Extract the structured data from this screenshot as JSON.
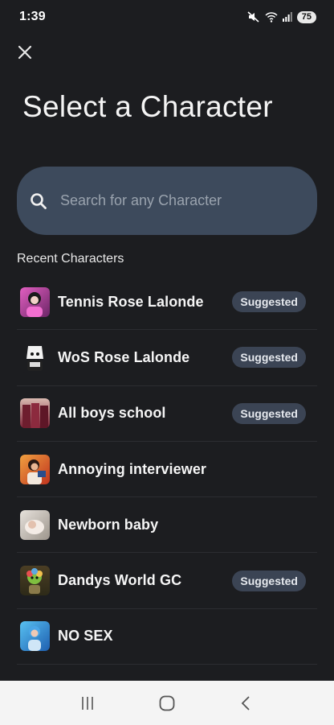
{
  "status_bar": {
    "time": "1:39",
    "battery": "75",
    "icons": [
      "mute-icon",
      "wifi-icon",
      "signal-icon",
      "battery-icon"
    ]
  },
  "header": {
    "close_icon": "close-icon",
    "title": "Select a Character"
  },
  "search": {
    "placeholder": "Search for any Character",
    "value": "",
    "icon": "search-icon"
  },
  "recent": {
    "label": "Recent Characters",
    "items": [
      {
        "name": "Tennis Rose Lalonde",
        "badge": "Suggested",
        "avatar_color": "#b04a9e"
      },
      {
        "name": "WoS Rose Lalonde",
        "badge": "Suggested",
        "avatar_color": "#e0e0e0"
      },
      {
        "name": "All boys school",
        "badge": "Suggested",
        "avatar_color": "#8a2f3f"
      },
      {
        "name": "Annoying interviewer",
        "badge": "",
        "avatar_color": "#d07a3a"
      },
      {
        "name": "Newborn baby",
        "badge": "",
        "avatar_color": "#c9c4bd"
      },
      {
        "name": "Dandys World GC",
        "badge": "Suggested",
        "avatar_color": "#6a5a2e"
      },
      {
        "name": "NO SEX",
        "badge": "",
        "avatar_color": "#3a9ad8"
      }
    ]
  },
  "nav_bar": {
    "icons": [
      "recent-apps-icon",
      "home-icon",
      "back-icon"
    ]
  },
  "colors": {
    "background": "#1c1d20",
    "search_bg": "#3d4a5c",
    "badge_bg": "#3b4454",
    "nav_bg": "#f4f4f4"
  }
}
